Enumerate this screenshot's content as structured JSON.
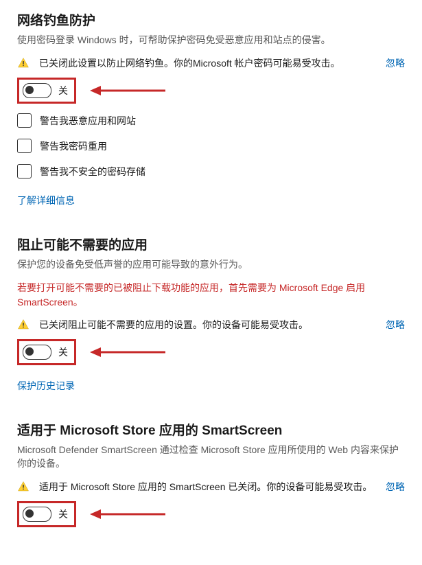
{
  "section1": {
    "title": "网络钓鱼防护",
    "desc": "使用密码登录 Windows 时，可帮助保护密码免受恶意应用和站点的侵害。",
    "warning": "已关闭此设置以防止网络钓鱼。你的Microsoft 帐户密码可能易受攻击。",
    "ignore": "忽略",
    "toggle_label": "关",
    "check1": "警告我恶意应用和网站",
    "check2": "警告我密码重用",
    "check3": "警告我不安全的密码存储",
    "link": "了解详细信息"
  },
  "section2": {
    "title": "阻止可能不需要的应用",
    "desc": "保护您的设备免受低声誉的应用可能导致的意外行为。",
    "red_note": "若要打开可能不需要的已被阻止下载功能的应用，首先需要为 Microsoft Edge 启用 SmartScreen。",
    "warning": "已关闭阻止可能不需要的应用的设置。你的设备可能易受攻击。",
    "ignore": "忽略",
    "toggle_label": "关",
    "link": "保护历史记录"
  },
  "section3": {
    "title": "适用于 Microsoft Store 应用的 SmartScreen",
    "desc": "Microsoft Defender SmartScreen 通过检查 Microsoft Store 应用所使用的 Web 内容来保护你的设备。",
    "warning": "适用于 Microsoft Store 应用的 SmartScreen 已关闭。你的设备可能易受攻击。",
    "ignore": "忽略",
    "toggle_label": "关"
  }
}
